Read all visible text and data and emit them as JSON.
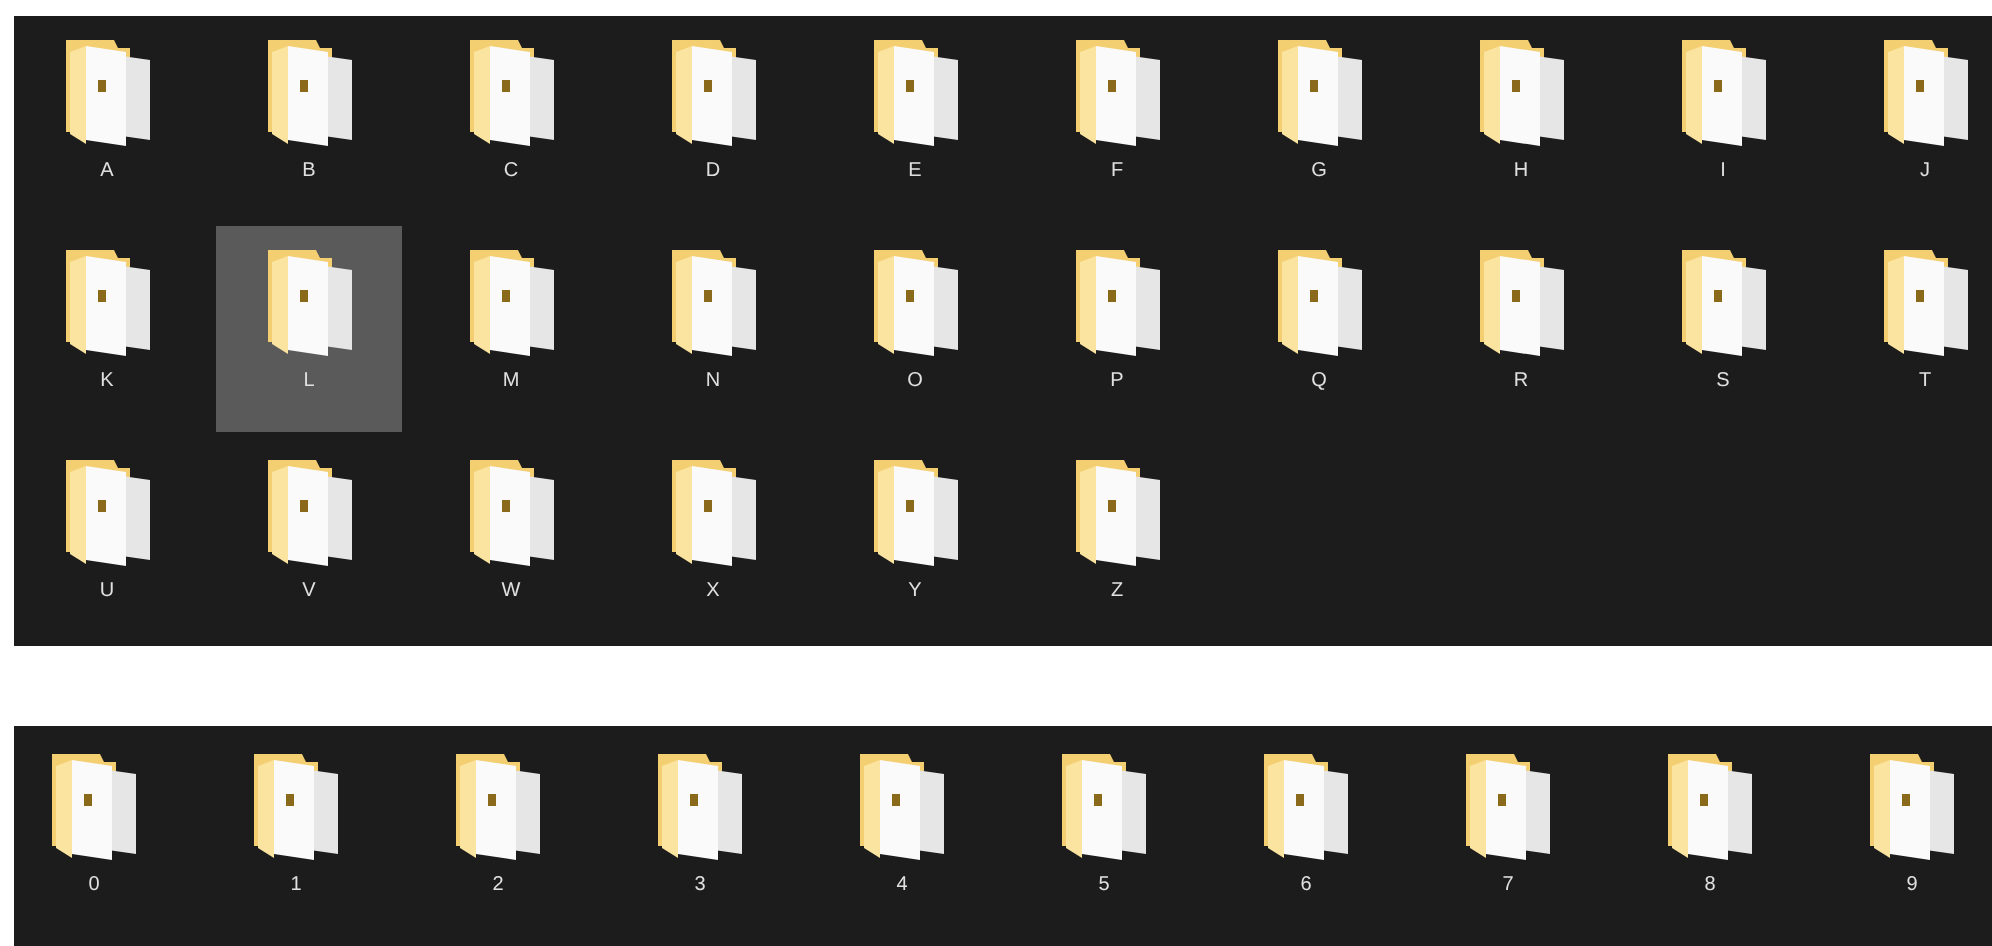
{
  "letter_folders": [
    {
      "label": "A",
      "selected": false
    },
    {
      "label": "B",
      "selected": false
    },
    {
      "label": "C",
      "selected": false
    },
    {
      "label": "D",
      "selected": false
    },
    {
      "label": "E",
      "selected": false
    },
    {
      "label": "F",
      "selected": false
    },
    {
      "label": "G",
      "selected": false
    },
    {
      "label": "H",
      "selected": false
    },
    {
      "label": "I",
      "selected": false
    },
    {
      "label": "J",
      "selected": false
    },
    {
      "label": "K",
      "selected": false
    },
    {
      "label": "L",
      "selected": true
    },
    {
      "label": "M",
      "selected": false
    },
    {
      "label": "N",
      "selected": false
    },
    {
      "label": "O",
      "selected": false
    },
    {
      "label": "P",
      "selected": false
    },
    {
      "label": "Q",
      "selected": false
    },
    {
      "label": "R",
      "selected": false
    },
    {
      "label": "S",
      "selected": false
    },
    {
      "label": "T",
      "selected": false
    },
    {
      "label": "U",
      "selected": false
    },
    {
      "label": "V",
      "selected": false
    },
    {
      "label": "W",
      "selected": false
    },
    {
      "label": "X",
      "selected": false
    },
    {
      "label": "Y",
      "selected": false
    },
    {
      "label": "Z",
      "selected": false
    }
  ],
  "digit_folders": [
    {
      "label": "0",
      "selected": false
    },
    {
      "label": "1",
      "selected": false
    },
    {
      "label": "2",
      "selected": false
    },
    {
      "label": "3",
      "selected": false
    },
    {
      "label": "4",
      "selected": false
    },
    {
      "label": "5",
      "selected": false
    },
    {
      "label": "6",
      "selected": false
    },
    {
      "label": "7",
      "selected": false
    },
    {
      "label": "8",
      "selected": false
    },
    {
      "label": "9",
      "selected": false
    }
  ]
}
